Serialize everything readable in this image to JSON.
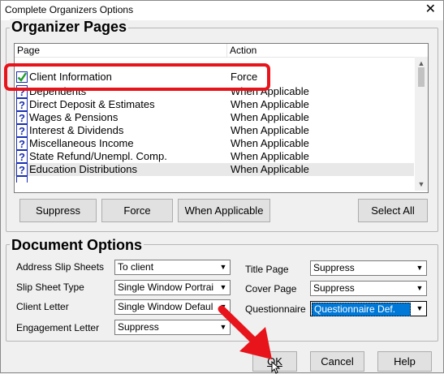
{
  "window": {
    "title": "Complete Organizers Options",
    "close_glyph": "✕"
  },
  "organizer_pages": {
    "legend": "Organizer Pages",
    "columns": {
      "page": "Page",
      "action": "Action"
    },
    "rows": [
      {
        "icon": "question-icon",
        "page": "Dependents",
        "action": "When Applicable"
      },
      {
        "icon": "question-icon",
        "page": "Direct Deposit & Estimates",
        "action": "When Applicable"
      },
      {
        "icon": "question-icon",
        "page": "Wages & Pensions",
        "action": "When Applicable"
      },
      {
        "icon": "question-icon",
        "page": "Interest & Dividends",
        "action": "When Applicable"
      },
      {
        "icon": "question-icon",
        "page": "Miscellaneous Income",
        "action": "When Applicable"
      },
      {
        "icon": "question-icon",
        "page": "State Refund/Unempl. Comp.",
        "action": "When Applicable"
      },
      {
        "icon": "question-icon",
        "page": "Education Distributions",
        "action": "When Applicable"
      }
    ],
    "highlight_row": {
      "icon": "checkmark-icon",
      "page": "Client Information",
      "action": "Force"
    },
    "buttons": {
      "suppress": "Suppress",
      "force": "Force",
      "when_applicable": "When Applicable",
      "select_all": "Select All"
    }
  },
  "document_options": {
    "legend": "Document Options",
    "address_slip_sheets": {
      "label": "Address Slip Sheets",
      "value": "To client"
    },
    "slip_sheet_type": {
      "label": "Slip Sheet Type",
      "value": "Single Window Portrai"
    },
    "client_letter": {
      "label": "Client Letter",
      "value": "Single Window Defaul"
    },
    "engagement_letter": {
      "label": "Engagement Letter",
      "value": "Suppress"
    },
    "title_page": {
      "label": "Title Page",
      "value": "Suppress"
    },
    "cover_page": {
      "label": "Cover Page",
      "value": "Suppress"
    },
    "questionnaire": {
      "label": "Questionnaire",
      "value": "Questionnaire Def."
    }
  },
  "footer": {
    "ok": "OK",
    "cancel": "Cancel",
    "help": "Help"
  },
  "colors": {
    "annotation_red": "#e8141b",
    "selection_blue": "#0078d7",
    "checkmark_green": "#1e9e2a",
    "question_blue": "#1a2fb0"
  }
}
